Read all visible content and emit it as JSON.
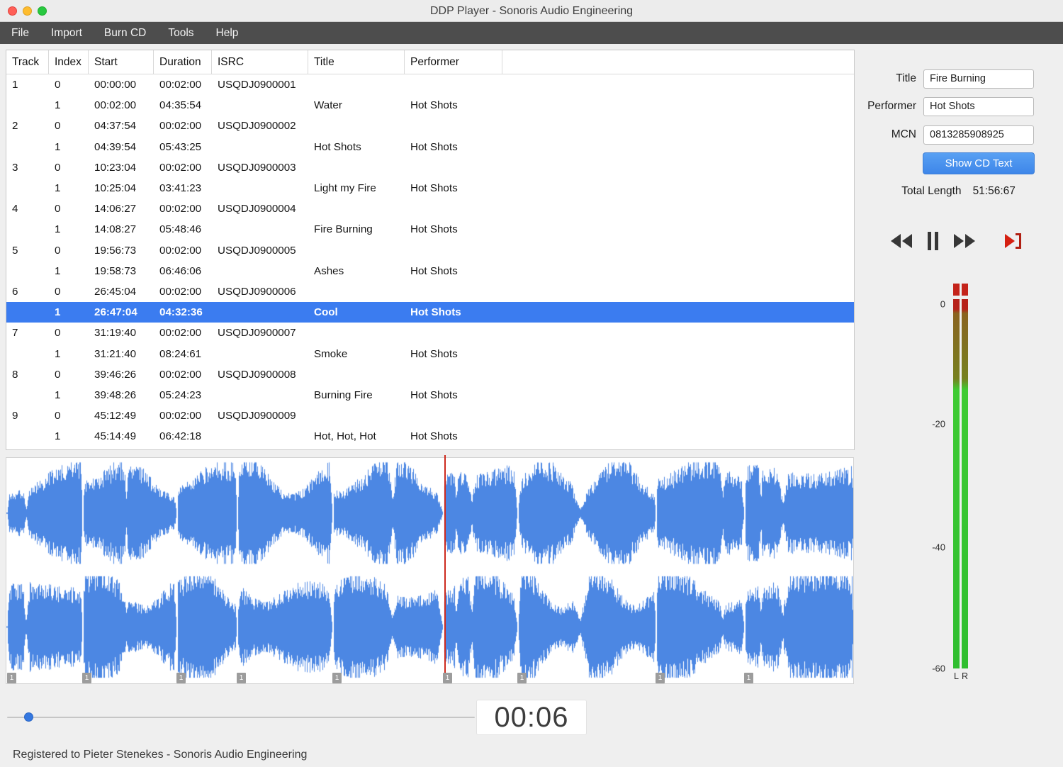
{
  "window": {
    "title": "DDP Player - Sonoris Audio Engineering",
    "status_bar": "Registered to Pieter Stenekes - Sonoris Audio Engineering"
  },
  "menu": {
    "items": [
      "File",
      "Import",
      "Burn CD",
      "Tools",
      "Help"
    ]
  },
  "table": {
    "columns": [
      "Track",
      "Index",
      "Start",
      "Duration",
      "ISRC",
      "Title",
      "Performer"
    ],
    "rows": [
      {
        "track": "1",
        "index": "0",
        "start": "00:00:00",
        "duration": "00:02:00",
        "isrc": "USQDJ0900001",
        "title": "",
        "performer": "",
        "selected": false
      },
      {
        "track": "",
        "index": "1",
        "start": "00:02:00",
        "duration": "04:35:54",
        "isrc": "",
        "title": "Water",
        "performer": "Hot Shots",
        "selected": false
      },
      {
        "track": "2",
        "index": "0",
        "start": "04:37:54",
        "duration": "00:02:00",
        "isrc": "USQDJ0900002",
        "title": "",
        "performer": "",
        "selected": false
      },
      {
        "track": "",
        "index": "1",
        "start": "04:39:54",
        "duration": "05:43:25",
        "isrc": "",
        "title": "Hot Shots",
        "performer": "Hot Shots",
        "selected": false
      },
      {
        "track": "3",
        "index": "0",
        "start": "10:23:04",
        "duration": "00:02:00",
        "isrc": "USQDJ0900003",
        "title": "",
        "performer": "",
        "selected": false
      },
      {
        "track": "",
        "index": "1",
        "start": "10:25:04",
        "duration": "03:41:23",
        "isrc": "",
        "title": "Light my Fire",
        "performer": "Hot Shots",
        "selected": false
      },
      {
        "track": "4",
        "index": "0",
        "start": "14:06:27",
        "duration": "00:02:00",
        "isrc": "USQDJ0900004",
        "title": "",
        "performer": "",
        "selected": false
      },
      {
        "track": "",
        "index": "1",
        "start": "14:08:27",
        "duration": "05:48:46",
        "isrc": "",
        "title": "Fire Burning",
        "performer": "Hot Shots",
        "selected": false
      },
      {
        "track": "5",
        "index": "0",
        "start": "19:56:73",
        "duration": "00:02:00",
        "isrc": "USQDJ0900005",
        "title": "",
        "performer": "",
        "selected": false
      },
      {
        "track": "",
        "index": "1",
        "start": "19:58:73",
        "duration": "06:46:06",
        "isrc": "",
        "title": "Ashes",
        "performer": "Hot Shots",
        "selected": false
      },
      {
        "track": "6",
        "index": "0",
        "start": "26:45:04",
        "duration": "00:02:00",
        "isrc": "USQDJ0900006",
        "title": "",
        "performer": "",
        "selected": false
      },
      {
        "track": "",
        "index": "1",
        "start": "26:47:04",
        "duration": "04:32:36",
        "isrc": "",
        "title": "Cool",
        "performer": "Hot Shots",
        "selected": true
      },
      {
        "track": "7",
        "index": "0",
        "start": "31:19:40",
        "duration": "00:02:00",
        "isrc": "USQDJ0900007",
        "title": "",
        "performer": "",
        "selected": false
      },
      {
        "track": "",
        "index": "1",
        "start": "31:21:40",
        "duration": "08:24:61",
        "isrc": "",
        "title": "Smoke",
        "performer": "Hot Shots",
        "selected": false
      },
      {
        "track": "8",
        "index": "0",
        "start": "39:46:26",
        "duration": "00:02:00",
        "isrc": "USQDJ0900008",
        "title": "",
        "performer": "",
        "selected": false
      },
      {
        "track": "",
        "index": "1",
        "start": "39:48:26",
        "duration": "05:24:23",
        "isrc": "",
        "title": "Burning Fire",
        "performer": "Hot Shots",
        "selected": false
      },
      {
        "track": "9",
        "index": "0",
        "start": "45:12:49",
        "duration": "00:02:00",
        "isrc": "USQDJ0900009",
        "title": "",
        "performer": "",
        "selected": false
      },
      {
        "track": "",
        "index": "1",
        "start": "45:14:49",
        "duration": "06:42:18",
        "isrc": "",
        "title": "Hot, Hot, Hot",
        "performer": "Hot Shots",
        "selected": false
      }
    ]
  },
  "details": {
    "title_label": "Title",
    "title_value": "Fire Burning",
    "performer_label": "Performer",
    "performer_value": "Hot Shots",
    "mcn_label": "MCN",
    "mcn_value": "0813285908925",
    "show_cd_text_label": "Show CD Text",
    "total_length_label": "Total Length",
    "total_length_value": "51:56:67"
  },
  "transport": {
    "icons": [
      "rewind-icon",
      "pause-icon",
      "fast-forward-icon",
      "play-to-marker-icon"
    ]
  },
  "meter": {
    "scale_labels": [
      "0",
      "-20",
      "-40",
      "-60"
    ],
    "scale_fractions": [
      0.053,
      0.365,
      0.685,
      1.0
    ],
    "channel_labels": [
      "L",
      "R"
    ]
  },
  "player": {
    "time_display": "00:06"
  },
  "waveform": {
    "marker_label": "1",
    "track_start_fractions": [
      0.0006,
      0.0897,
      0.2005,
      0.2722,
      0.3847,
      0.5156,
      0.6036,
      0.7662,
      0.8709
    ],
    "playhead_fraction": 0.5175,
    "color": "#4c87e3",
    "playhead_color": "#cd2a1e"
  },
  "colors": {
    "selection": "#3b7cf0",
    "accent": "#4a90e8",
    "meter_green": "#3ecb33",
    "meter_red": "#c4231a"
  }
}
